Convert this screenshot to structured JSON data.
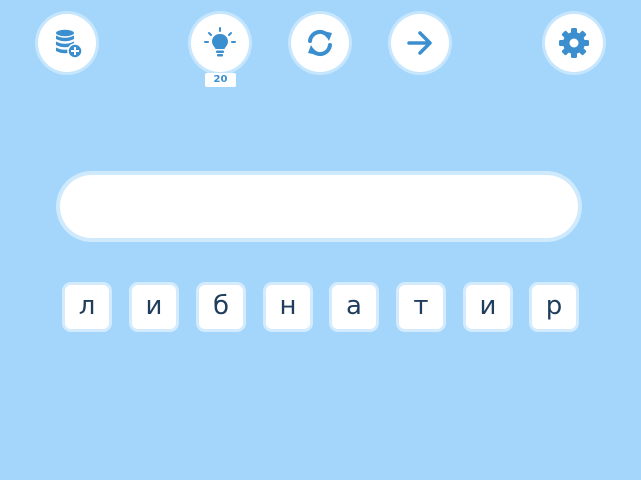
{
  "toolbar": {
    "coins_icon": "coins-add-icon",
    "hint_icon": "lightbulb-icon",
    "hint_count": "20",
    "refresh_icon": "refresh-icon",
    "next_icon": "arrow-right-icon",
    "settings_icon": "gear-icon"
  },
  "answer": {
    "value": ""
  },
  "letters": [
    "л",
    "и",
    "б",
    "н",
    "а",
    "т",
    "и",
    "р"
  ],
  "colors": {
    "background": "#a4d6fb",
    "icon": "#3c8fcf",
    "letter": "#1f3d5c",
    "tile_border": "#d3ebfd"
  }
}
